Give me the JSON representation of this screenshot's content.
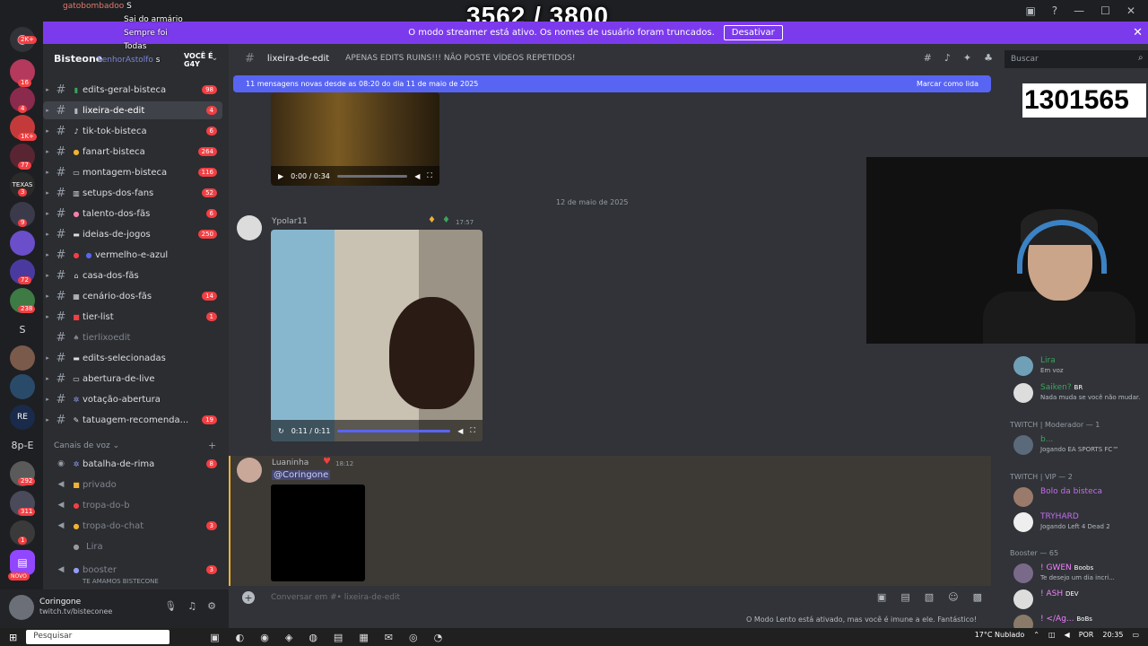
{
  "overlay": {
    "counter": "3562 / 3800",
    "chat": [
      {
        "name": "gatobombadoo",
        "msg": "S"
      },
      {
        "name": "",
        "msg": "Sai do armário"
      },
      {
        "name": "",
        "msg": "Sempre foi"
      },
      {
        "name": "",
        "msg": "Todas"
      },
      {
        "name": "SenhorAstolfo",
        "msg": "s"
      }
    ],
    "voce_e": "VOCÊ É G4Y",
    "score": "1301565"
  },
  "banner": {
    "text": "O modo streamer está ativo. Os nomes de usuário foram truncados.",
    "button": "Desativar"
  },
  "server": {
    "name": "Bisteone",
    "voice_category": "Canais de voz"
  },
  "rail": {
    "badges": [
      "2K+",
      "16",
      "4",
      "1K+",
      "77",
      "3",
      "9",
      "72",
      "238",
      "292",
      "311",
      "1"
    ],
    "letters": [
      "S",
      "8p-E"
    ],
    "novo": "NOVO"
  },
  "channels": [
    {
      "name": "edits-geral-bisteca",
      "badge": "98"
    },
    {
      "name": "lixeira-de-edit",
      "badge": "4"
    },
    {
      "name": "tik-tok-bisteca",
      "badge": "6"
    },
    {
      "name": "fanart-bisteca",
      "badge": "264"
    },
    {
      "name": "montagem-bisteca",
      "badge": "116"
    },
    {
      "name": "setups-dos-fans",
      "badge": "52"
    },
    {
      "name": "talento-dos-fãs",
      "badge": "6"
    },
    {
      "name": "ideias-de-jogos",
      "badge": "250"
    },
    {
      "name": "vermelho-e-azul",
      "badge": ""
    },
    {
      "name": "casa-dos-fãs",
      "badge": ""
    },
    {
      "name": "cenário-dos-fãs",
      "badge": "14"
    },
    {
      "name": "tier-list",
      "badge": "1"
    },
    {
      "name": "tierlixoedit",
      "badge": ""
    },
    {
      "name": "edits-selecionadas",
      "badge": ""
    },
    {
      "name": "abertura-de-live",
      "badge": ""
    },
    {
      "name": "votação-abertura",
      "badge": ""
    },
    {
      "name": "tatuagem-recomenda...",
      "badge": "19"
    }
  ],
  "voice_channels": [
    {
      "name": "batalha-de-rima",
      "badge": "8"
    },
    {
      "name": "privado",
      "badge": ""
    },
    {
      "name": "tropa-do-b",
      "badge": ""
    },
    {
      "name": "tropa-do-chat",
      "badge": "3"
    },
    {
      "name": "Lira",
      "badge": ""
    },
    {
      "name": "booster",
      "badge": "3"
    }
  ],
  "voice_sub": "TE AMAMOS BISTECONE",
  "user": {
    "name": "Coringone",
    "status": "twitch.tv/bisteconee"
  },
  "chat": {
    "channel": "lixeira-de-edit",
    "topic": "APENAS EDITS RUINS!!! NÃO POSTE VÍDEOS REPETIDOS!",
    "new_messages": "11 mensagens novas desde as 08:20 do dia 11 de maio de 2025",
    "mark_read": "Marcar como lida",
    "video1_time": "0:00 / 0:34",
    "date_sep": "12 de maio de 2025",
    "msg1_author": "Ypolar11",
    "msg1_time": "17:57",
    "video2_time": "0:11 / 0:11",
    "msg2_author": "Luaninha",
    "msg2_time": "18:12",
    "msg2_mention": "@Coringone",
    "input_placeholder": "Conversar em #• lixeira-de-edit",
    "slowmode": "O Modo Lento está ativado, mas você é imune a ele. Fantástico!"
  },
  "search": {
    "placeholder": "Buscar"
  },
  "members": {
    "top_name": "Lira",
    "top_sub": "Em voz",
    "m2_name": "Saiken?",
    "m2_tag": "BR",
    "m2_sub": "Nada muda se você não mudar.",
    "role1": "TWITCH | Moderador — 1",
    "m3_name": "b...",
    "m3_sub": "Jogando EA SPORTS FC™",
    "role2": "TWITCH | VIP — 2",
    "m4_name": "Bolo da bisteca",
    "m5_name": "TRYHARD",
    "m5_sub": "Jogando Left 4 Dead 2",
    "role3": "Booster — 65",
    "m6_name": "! GWEN",
    "m6_tag": "Boobs",
    "m6_sub": "Te desejo um dia incri...",
    "m7_name": "! ASH",
    "m7_tag": "DEV",
    "m8_name": "! </Ag...",
    "m8_tag": "BoBs"
  },
  "taskbar": {
    "search": "Pesquisar",
    "weather": "17°C  Nublado",
    "lang": "POR",
    "time": "20:35"
  },
  "colors": {
    "accent": "#5865f2",
    "banner": "#7c3aed",
    "badge": "#f23f43"
  }
}
